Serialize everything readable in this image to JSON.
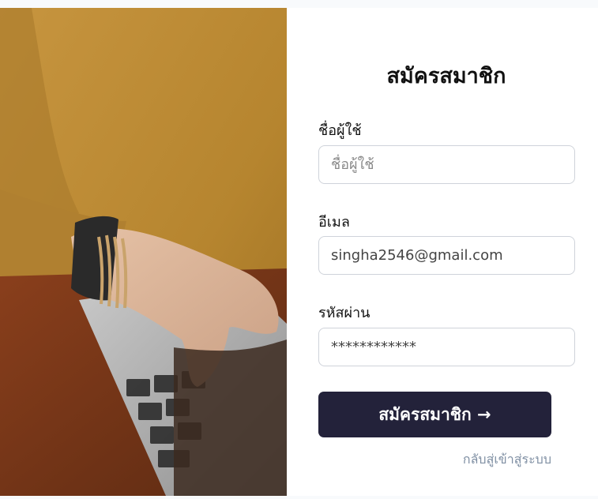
{
  "form": {
    "title": "สมัครสมาชิก",
    "username_label": "ชื่อผู้ใช้",
    "username_placeholder": "ชื่อผู้ใช้",
    "username_value": "",
    "email_label": "อีเมล",
    "email_value": "singha2546@gmail.com",
    "password_label": "รหัสผ่าน",
    "password_value": "************",
    "submit_label": "สมัครสมาชิก →",
    "back_link": "กลับสู่เข้าสู่ระบบ"
  },
  "colors": {
    "button": "#23223a",
    "link": "#7f8fa3",
    "field_border": "#cfd3da"
  }
}
